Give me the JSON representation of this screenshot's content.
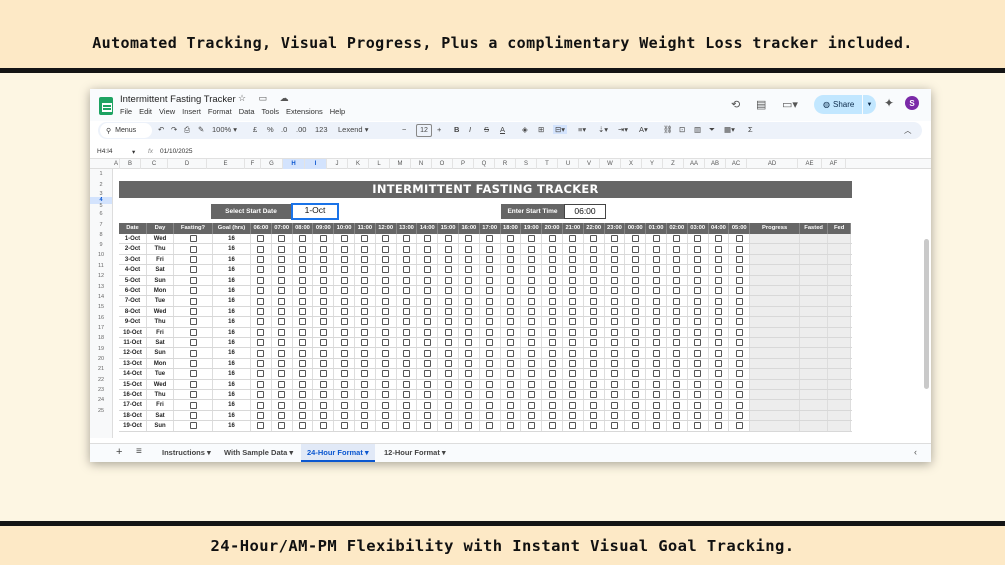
{
  "banners": {
    "top": "Automated Tracking, Visual Progress, Plus a complimentary Weight Loss tracker included.",
    "bottom": "24-Hour/AM-PM Flexibility with Instant Visual Goal Tracking."
  },
  "window": {
    "doc_title": "Intermittent Fasting Tracker",
    "title_icons": "☆ ▭ ☁",
    "menus": [
      "File",
      "Edit",
      "View",
      "Insert",
      "Format",
      "Data",
      "Tools",
      "Extensions",
      "Help"
    ],
    "share_label": "Share",
    "avatar_letter": "S"
  },
  "toolbar": {
    "menus_label": "Menus",
    "zoom": "100%",
    "format_euro": "£",
    "format_percent": "%",
    "dec_less": ".0",
    "dec_more": ".00",
    "format_123": "123",
    "font": "Lexend",
    "font_size": "12",
    "bold": "B",
    "italic": "I",
    "strike": "S",
    "text_color": "A",
    "sum": "Σ"
  },
  "formula_bar": {
    "cell_ref": "H4:I4",
    "fx": "fx",
    "value": "01/10/2025"
  },
  "columns": [
    "A",
    "B",
    "C",
    "D",
    "E",
    "F",
    "G",
    "H",
    "I",
    "J",
    "K",
    "L",
    "M",
    "N",
    "O",
    "P",
    "Q",
    "R",
    "S",
    "T",
    "U",
    "V",
    "W",
    "X",
    "Y",
    "Z",
    "AA",
    "AB",
    "AC",
    "AD",
    "AE",
    "AF"
  ],
  "row_numbers": [
    "1",
    "2",
    "3",
    "4",
    "5",
    "6",
    "7",
    "8",
    "9",
    "10",
    "11",
    "12",
    "13",
    "14",
    "15",
    "16",
    "17",
    "18",
    "19",
    "20",
    "21",
    "22",
    "23",
    "24",
    "25"
  ],
  "sheet": {
    "title": "INTERMITTENT FASTING TRACKER",
    "start_date_label": "Select Start Date",
    "start_date_value": "1-Oct",
    "start_time_label": "Enter Start Time",
    "start_time_value": "06:00",
    "headers": {
      "date": "Date",
      "day": "Day",
      "fasting": "Fasting?",
      "goal": "Goal (hrs)",
      "hours": [
        "06:00",
        "07:00",
        "08:00",
        "09:00",
        "10:00",
        "11:00",
        "12:00",
        "13:00",
        "14:00",
        "15:00",
        "16:00",
        "17:00",
        "18:00",
        "19:00",
        "20:00",
        "21:00",
        "22:00",
        "23:00",
        "00:00",
        "01:00",
        "02:00",
        "03:00",
        "04:00",
        "05:00"
      ],
      "progress": "Progress",
      "fasted": "Fasted",
      "fed": "Fed"
    },
    "rows": [
      {
        "date": "1-Oct",
        "day": "Wed",
        "goal": "16"
      },
      {
        "date": "2-Oct",
        "day": "Thu",
        "goal": "16"
      },
      {
        "date": "3-Oct",
        "day": "Fri",
        "goal": "16"
      },
      {
        "date": "4-Oct",
        "day": "Sat",
        "goal": "16"
      },
      {
        "date": "5-Oct",
        "day": "Sun",
        "goal": "16"
      },
      {
        "date": "6-Oct",
        "day": "Mon",
        "goal": "16"
      },
      {
        "date": "7-Oct",
        "day": "Tue",
        "goal": "16"
      },
      {
        "date": "8-Oct",
        "day": "Wed",
        "goal": "16"
      },
      {
        "date": "9-Oct",
        "day": "Thu",
        "goal": "16"
      },
      {
        "date": "10-Oct",
        "day": "Fri",
        "goal": "16"
      },
      {
        "date": "11-Oct",
        "day": "Sat",
        "goal": "16"
      },
      {
        "date": "12-Oct",
        "day": "Sun",
        "goal": "16"
      },
      {
        "date": "13-Oct",
        "day": "Mon",
        "goal": "16"
      },
      {
        "date": "14-Oct",
        "day": "Tue",
        "goal": "16"
      },
      {
        "date": "15-Oct",
        "day": "Wed",
        "goal": "16"
      },
      {
        "date": "16-Oct",
        "day": "Thu",
        "goal": "16"
      },
      {
        "date": "17-Oct",
        "day": "Fri",
        "goal": "16"
      },
      {
        "date": "18-Oct",
        "day": "Sat",
        "goal": "16"
      },
      {
        "date": "19-Oct",
        "day": "Sun",
        "goal": "16"
      }
    ]
  },
  "tabs": [
    {
      "label": "Instructions",
      "active": false
    },
    {
      "label": "With Sample Data",
      "active": false
    },
    {
      "label": "24-Hour Format",
      "active": true
    },
    {
      "label": "12-Hour Format",
      "active": false
    }
  ]
}
